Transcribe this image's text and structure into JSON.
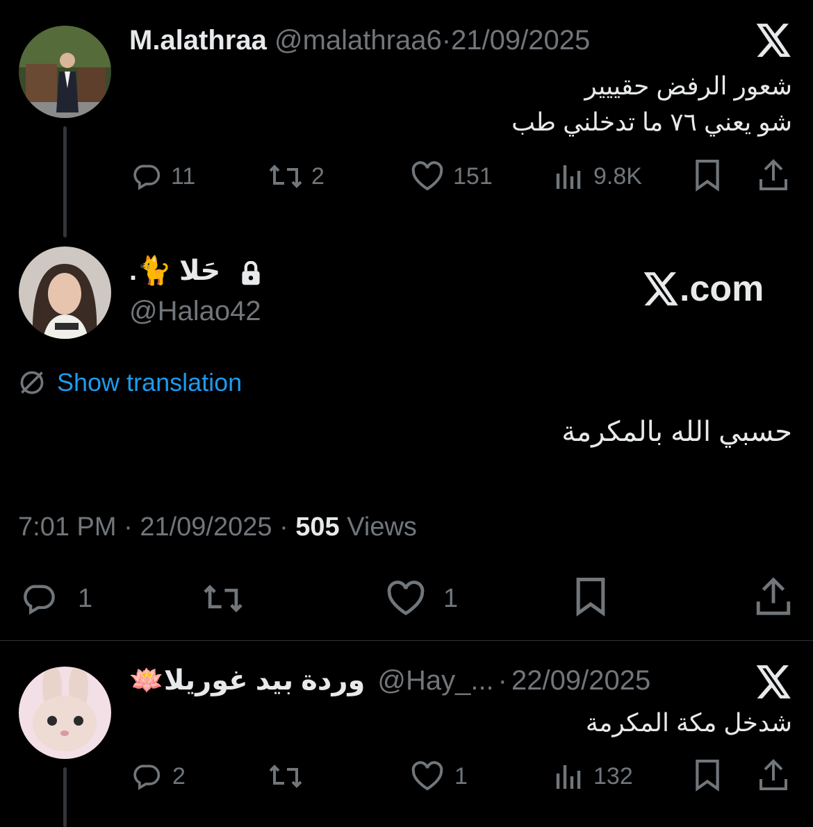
{
  "tweet1": {
    "name": "M.alathraa",
    "handle": "@malathraa6",
    "sep": "·",
    "date": "21/09/2025",
    "line1": "شعور الرفض حقييير",
    "line2": "شو يعني ٧٦ ما تدخلني طب",
    "replies": "11",
    "reposts": "2",
    "likes": "151",
    "views": "9.8K"
  },
  "tweet2": {
    "name": "حَلا 🐈.",
    "handle": "@Halao42",
    "brand": "X.com",
    "show_translation": "Show translation",
    "body": "حسبي الله بالمكرمة",
    "time": "7:01 PM",
    "sep": "·",
    "date": "21/09/2025",
    "views_count": "505",
    "views_label": "Views",
    "replies": "1",
    "likes": "1"
  },
  "tweet3": {
    "name": "وردة بيد غوريلا🪷",
    "handle": "@Hay_...",
    "sep": "·",
    "date": "22/09/2025",
    "body": "شدخل مكة المكرمة",
    "replies": "2",
    "likes": "1",
    "views": "132"
  },
  "colors": {
    "background": "#000000",
    "text": "#e7e9ea",
    "muted": "#71767b",
    "link": "#1d9bf0"
  }
}
